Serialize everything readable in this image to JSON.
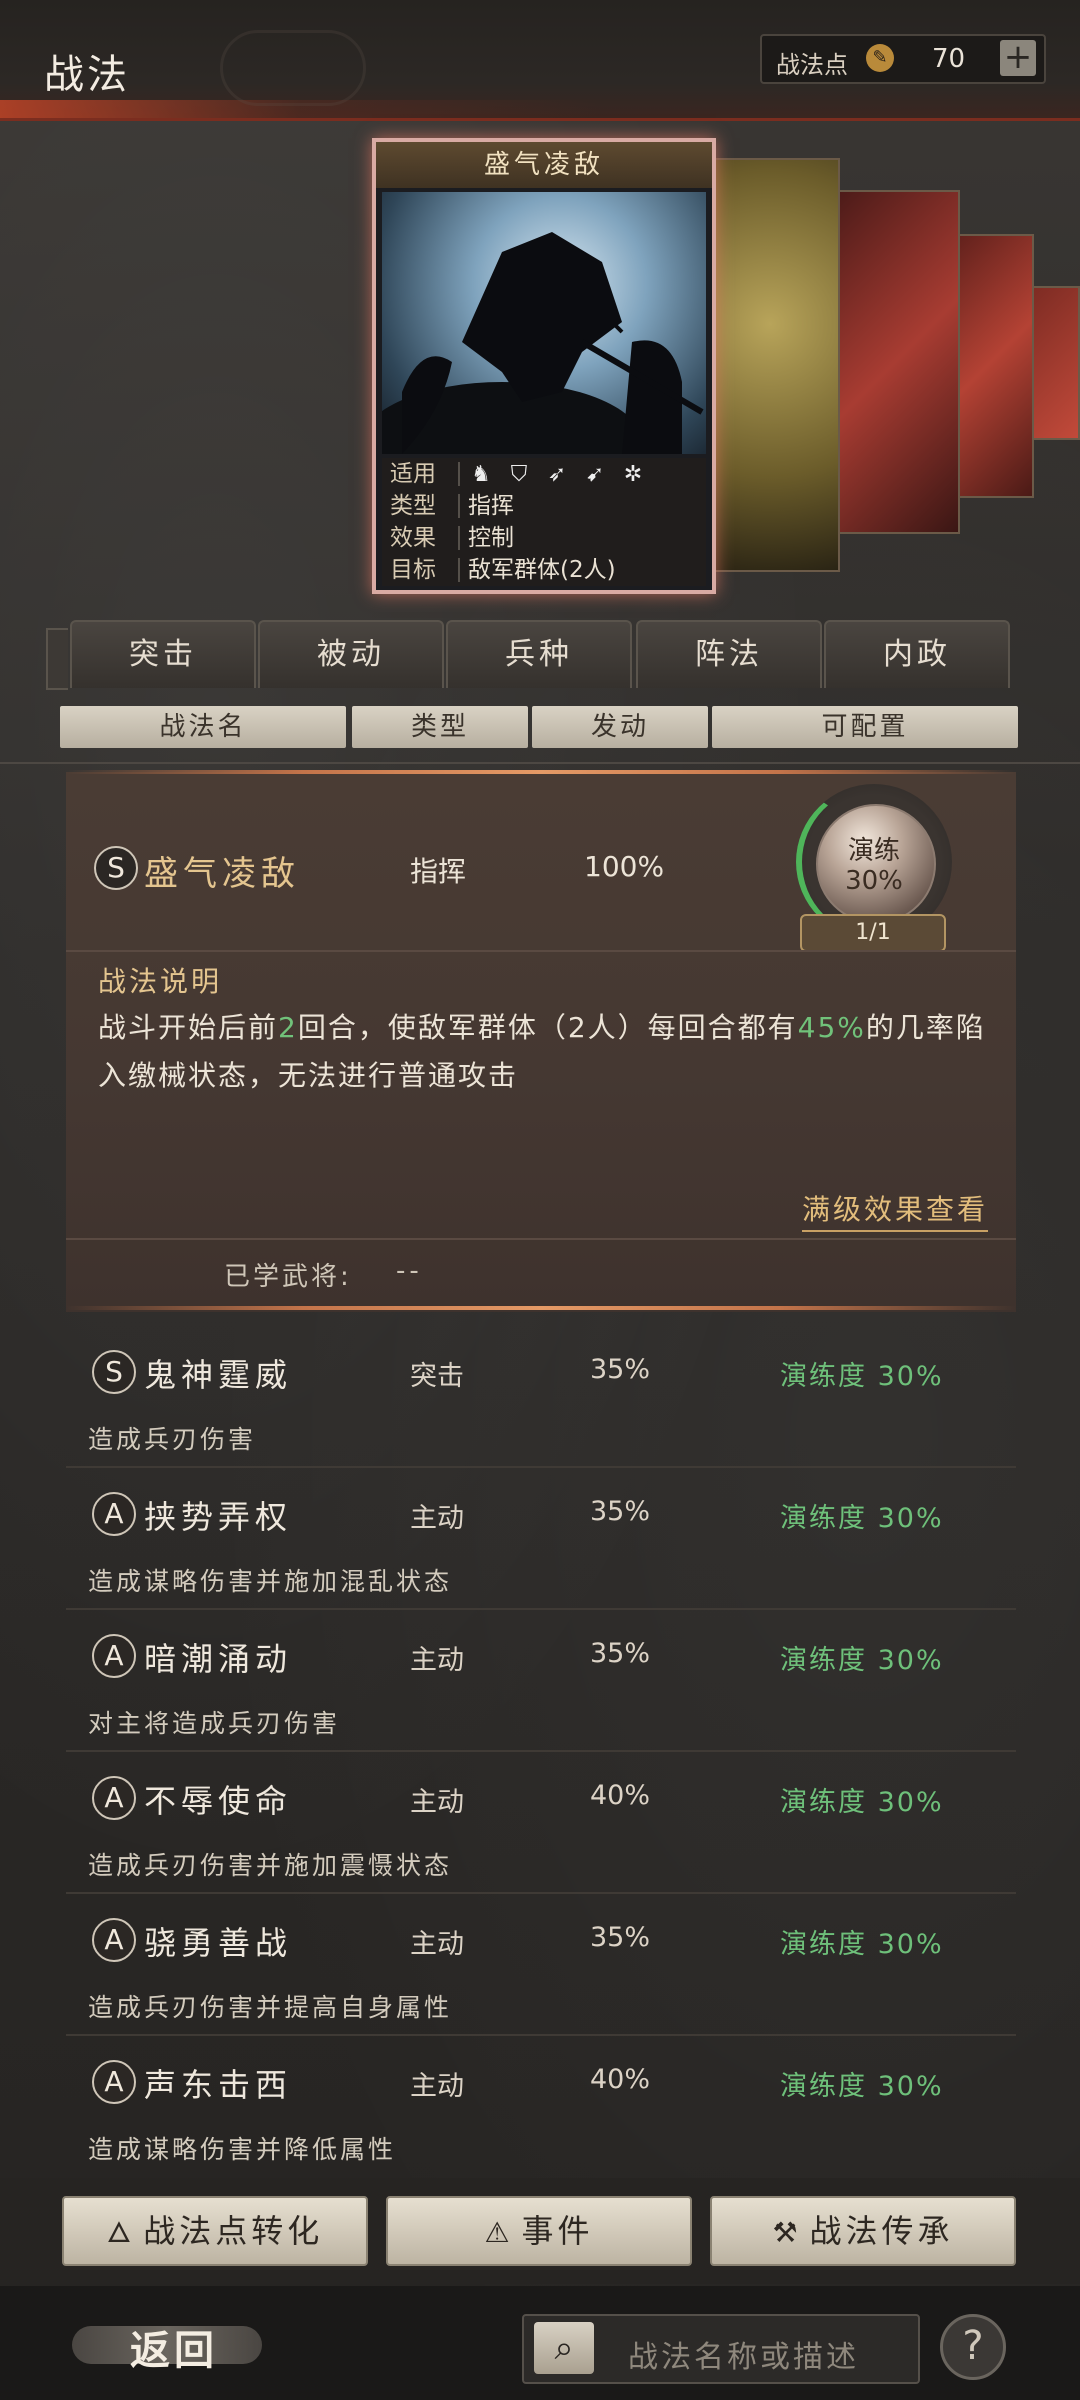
{
  "header": {
    "title": "战法",
    "points_label": "战法点",
    "points_value": "70",
    "plus_label": "+"
  },
  "card": {
    "title": "盛气凌敌",
    "info": [
      {
        "key": "适用",
        "value": ""
      },
      {
        "key": "类型",
        "value": "指挥"
      },
      {
        "key": "效果",
        "value": "控制"
      },
      {
        "key": "目标",
        "value": "敌军群体(2人)"
      }
    ],
    "unit_icons": [
      "cavalry-icon",
      "shield-icon",
      "bow-icon",
      "spear-icon",
      "siege-icon"
    ]
  },
  "tabs": [
    "突击",
    "被动",
    "兵种",
    "阵法",
    "内政"
  ],
  "columns": [
    "战法名",
    "类型",
    "发动",
    "可配置"
  ],
  "selected": {
    "grade": "S",
    "name": "盛气凌敌",
    "type": "指挥",
    "rate": "100%",
    "drill_label": "演练",
    "drill_pct": "30%",
    "drill_count": "1/1",
    "desc_title": "战法说明",
    "desc_parts": [
      "战斗开始后前",
      "2",
      "回合，使敌军群体（2人）每回合都有",
      "45%",
      "的几率陷入缴械状态，无法进行普通攻击"
    ],
    "full_effect_link": "满级效果查看",
    "learned_label": "已学武将:",
    "learned_value": "--"
  },
  "list": [
    {
      "grade": "S",
      "name": "鬼神霆威",
      "type": "突击",
      "rate": "35%",
      "drill": "演练度 30%",
      "desc": "造成兵刃伤害"
    },
    {
      "grade": "A",
      "name": "挟势弄权",
      "type": "主动",
      "rate": "35%",
      "drill": "演练度 30%",
      "desc": "造成谋略伤害并施加混乱状态"
    },
    {
      "grade": "A",
      "name": "暗潮涌动",
      "type": "主动",
      "rate": "35%",
      "drill": "演练度 30%",
      "desc": "对主将造成兵刃伤害"
    },
    {
      "grade": "A",
      "name": "不辱使命",
      "type": "主动",
      "rate": "40%",
      "drill": "演练度 30%",
      "desc": "造成兵刃伤害并施加震慑状态"
    },
    {
      "grade": "A",
      "name": "骁勇善战",
      "type": "主动",
      "rate": "35%",
      "drill": "演练度 30%",
      "desc": "造成兵刃伤害并提高自身属性"
    },
    {
      "grade": "A",
      "name": "声东击西",
      "type": "主动",
      "rate": "40%",
      "drill": "演练度 30%",
      "desc": "造成谋略伤害并降低属性"
    }
  ],
  "buttons": {
    "convert": "战法点转化",
    "events": "事件",
    "inherit": "战法传承"
  },
  "footer": {
    "back": "返回",
    "search_placeholder": "战法名称或描述",
    "help": "?"
  },
  "colors": {
    "accent_gold": "#e4c58f",
    "highlight_green": "#71c27a",
    "header_red": "#7b2d1f"
  }
}
